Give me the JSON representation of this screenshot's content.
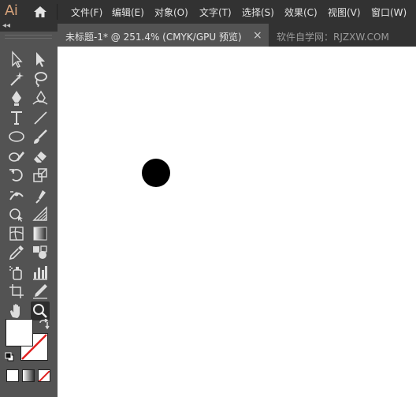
{
  "app": {
    "logo": "Ai"
  },
  "menu": [
    "文件(F)",
    "编辑(E)",
    "对象(O)",
    "文字(T)",
    "选择(S)",
    "效果(C)",
    "视图(V)",
    "窗口(W)"
  ],
  "tabs": {
    "active": {
      "label": "未标题-1* @ 251.4% (CMYK/GPU 预览)",
      "close": "×"
    },
    "inactive": {
      "label": "软件自学网：RJZXW.COM"
    }
  },
  "toolbar": {
    "collapse": "◂◂",
    "tools": [
      "selection-tool-icon",
      "direct-selection-tool-icon",
      "magic-wand-tool-icon",
      "lasso-tool-icon",
      "pen-tool-icon",
      "curvature-tool-icon",
      "type-tool-icon",
      "line-segment-tool-icon",
      "ellipse-tool-icon",
      "paintbrush-tool-icon",
      "shaper-tool-icon",
      "eraser-tool-icon",
      "rotate-tool-icon",
      "scale-tool-icon",
      "width-tool-icon",
      "puppet-warp-tool-icon",
      "shape-builder-tool-icon",
      "perspective-grid-tool-icon",
      "mesh-tool-icon",
      "gradient-tool-icon",
      "eyedropper-tool-icon",
      "blend-tool-icon",
      "symbol-sprayer-tool-icon",
      "column-graph-tool-icon",
      "artboard-tool-icon",
      "slice-tool-icon",
      "hand-tool-icon",
      "zoom-tool-icon"
    ],
    "active_tool": "zoom-tool-icon",
    "fill_color": "#ffffff",
    "stroke_color": "none"
  },
  "canvas": {
    "background": "#ffffff",
    "shape_fill": "#000000"
  }
}
